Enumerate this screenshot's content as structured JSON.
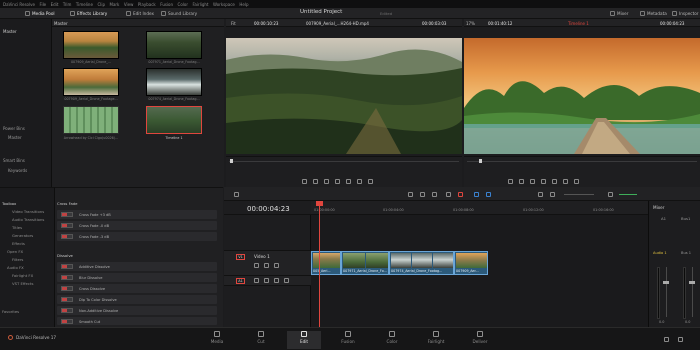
{
  "app": {
    "name": "DaVinci Resolve",
    "version_label": "DaVinci Resolve 17"
  },
  "menu": [
    "DaVinci Resolve",
    "File",
    "Edit",
    "Trim",
    "Timeline",
    "Clip",
    "Mark",
    "View",
    "Playback",
    "Fusion",
    "Color",
    "Fairlight",
    "Workspace",
    "Help"
  ],
  "toolbar": {
    "media_pool": "Media Pool",
    "effects_library": "Effects Library",
    "edit_index": "Edit Index",
    "sound_library": "Sound Library",
    "project_title": "Untitled Project",
    "project_status": "Edited",
    "mixer": "Mixer",
    "metadata": "Metadata",
    "inspector": "Inspector"
  },
  "media_pool": {
    "bin_header": "Master",
    "sidebar_root": "Master",
    "power_bins": "Power Bins",
    "power_bins_master": "Master",
    "smart_bins": "Smart Bins",
    "smart_bins_keywords": "Keywords",
    "clips": [
      {
        "label": "007909_Aerial_Drone_..."
      },
      {
        "label": "007971_Aerial_Drone_Footag..."
      },
      {
        "label": "007909_Aerial_Drone_Footage..."
      },
      {
        "label": "007974_Aerial_Drone_Footag..."
      },
      {
        "label": "Arrowhead by Cici Cigo(u0026)..."
      },
      {
        "label": "Timeline 1"
      }
    ]
  },
  "source_viewer": {
    "zoom": "Fit",
    "timecode_in": "00:00:10:23",
    "clip_name": "007909_Aerial_...H264-HD.mp4",
    "timecode_out": "00:00:03:03"
  },
  "program_viewer": {
    "zoom": "17%",
    "timecode": "00:01:40:12",
    "timeline_name": "Timeline 1",
    "timecode_out": "00:00:04:23"
  },
  "effects": {
    "toolbox": "Toolbox",
    "items": [
      "Video Transitions",
      "Audio Transitions",
      "Titles",
      "Generators",
      "Effects"
    ],
    "open_fx": "Open FX",
    "open_fx_items": [
      "Filters"
    ],
    "audio_fx": "Audio FX",
    "audio_fx_items": [
      "Fairlight FX",
      "VST Effects"
    ],
    "favorites": "Favorites",
    "cross_fade_header": "Cross Fade",
    "cross_fades": [
      "Cross Fade +3 dB",
      "Cross Fade -0 dB",
      "Cross Fade -3 dB"
    ],
    "dissolve_header": "Dissolve",
    "dissolves": [
      "Additive Dissolve",
      "Blur Dissolve",
      "Cross Dissolve",
      "Dip To Color Dissolve",
      "Non-Additive Dissolve",
      "Smooth Cut"
    ]
  },
  "timeline": {
    "timecode": "00:00:04:23",
    "ruler": [
      "01:00:00:00",
      "01:00:04:00",
      "01:00:08:00",
      "01:00:12:00",
      "01:00:16:00"
    ],
    "video_track": "Video 1",
    "video_track_id": "V1",
    "audio_track_id": "A1",
    "clips": [
      {
        "label": "005_Aeri..."
      },
      {
        "label": "007971_Aerial_Drone_Fo..."
      },
      {
        "label": "007974_Aerial_Drone_Footag..."
      },
      {
        "label": "007909_Aer..."
      }
    ]
  },
  "mixer": {
    "title": "Mixer",
    "a1": "A1",
    "bus1": "Bus1",
    "audio1": "Audio 1",
    "bus1_label": "Bus 1",
    "fader_a1": "0.0",
    "fader_bus": "0.0"
  },
  "pages": [
    "Media",
    "Cut",
    "Edit",
    "Fusion",
    "Color",
    "Fairlight",
    "Deliver"
  ],
  "active_page": "Edit",
  "colors": {
    "accent": "#e0463e",
    "clip": "#2c5a7a",
    "clip_border": "#6aa6d8",
    "bg": "#1c1c1e"
  }
}
